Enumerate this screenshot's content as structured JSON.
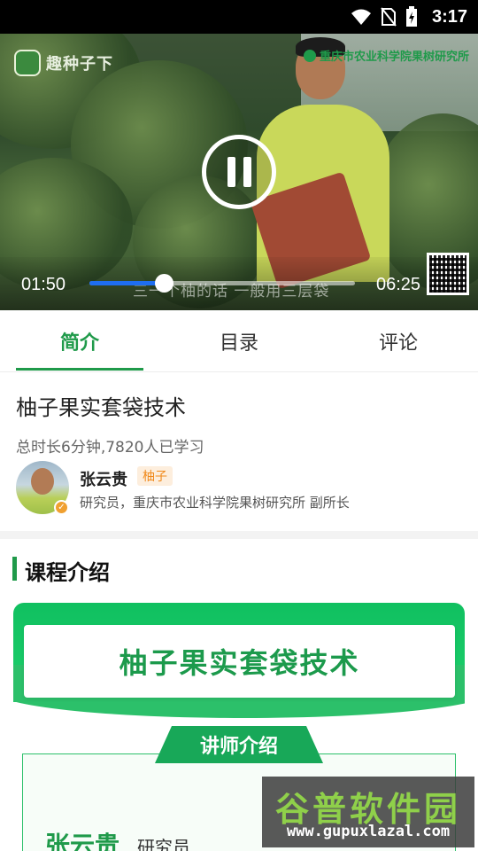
{
  "status_bar": {
    "time": "3:17"
  },
  "video": {
    "brand": "趣种子下",
    "institute": "重庆市农业科学院果树研究所",
    "subtitle": "三一个柚的话 一般用三层袋",
    "current_time": "01:50",
    "total_time": "06:25",
    "progress": 0.28
  },
  "tabs": [
    {
      "label": "简介",
      "active": true
    },
    {
      "label": "目录",
      "active": false
    },
    {
      "label": "评论",
      "active": false
    }
  ],
  "course": {
    "title": "柚子果实套袋技术",
    "meta": "总时长6分钟,7820人已学习"
  },
  "teacher": {
    "name": "张云贵",
    "tag": "柚子",
    "description": "研究员，重庆市农业科学院果树研究所 副所长"
  },
  "intro": {
    "section_title": "课程介绍",
    "banner_title": "柚子果实套袋技术",
    "badge": "讲师介绍",
    "panel_name": "张云贵",
    "panel_role": "研究员"
  },
  "watermark": {
    "title": "谷普软件园",
    "url": "www.gupuxlazal.com"
  },
  "colors": {
    "accent": "#1f9a4a",
    "progress": "#1e6ef0",
    "tag": "#f08a1c"
  }
}
